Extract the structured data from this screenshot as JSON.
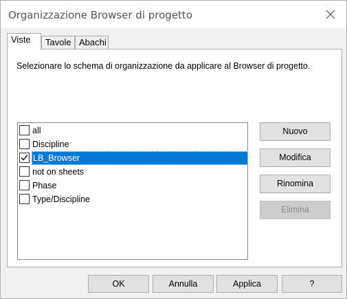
{
  "window": {
    "title": "Organizzazione Browser di progetto"
  },
  "tabs": [
    {
      "label": "Viste"
    },
    {
      "label": "Tavole"
    },
    {
      "label": "Abachi"
    }
  ],
  "panel": {
    "instruction": "Selezionare lo schema di organizzazione da applicare al Browser di progetto.",
    "schemes": [
      {
        "label": "all",
        "checked": false,
        "selected": false
      },
      {
        "label": "Discipline",
        "checked": false,
        "selected": false
      },
      {
        "label": "LB_Browser",
        "checked": true,
        "selected": true
      },
      {
        "label": "not on sheets",
        "checked": false,
        "selected": false
      },
      {
        "label": "Phase",
        "checked": false,
        "selected": false
      },
      {
        "label": "Type/Discipline",
        "checked": false,
        "selected": false
      }
    ],
    "buttons": {
      "new": "Nuovo",
      "edit": "Modifica",
      "rename": "Rinomina",
      "delete": "Elimina"
    }
  },
  "footer": {
    "ok": "OK",
    "cancel": "Annulla",
    "apply": "Applica",
    "help": "?"
  },
  "colors": {
    "selection": "#0078d7",
    "button_face": "#e1e1e1"
  }
}
